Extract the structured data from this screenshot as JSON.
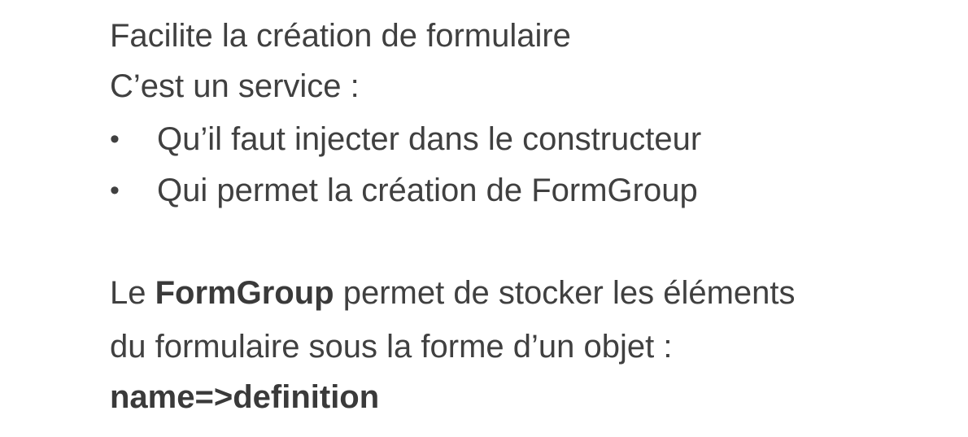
{
  "intro": {
    "line1": "Facilite la création de formulaire",
    "line2": "C’est un service :"
  },
  "bullets": [
    {
      "symbol": "•",
      "text": "Qu’il faut injecter dans le constructeur"
    },
    {
      "symbol": "•",
      "text": "Qui permet la création de FormGroup"
    }
  ],
  "paragraph": {
    "prefix": "Le ",
    "bold_term": "FormGroup",
    "suffix": " permet de stocker les éléments",
    "line2": "du formulaire sous la forme d’un objet :",
    "line3": "name=>definition"
  }
}
